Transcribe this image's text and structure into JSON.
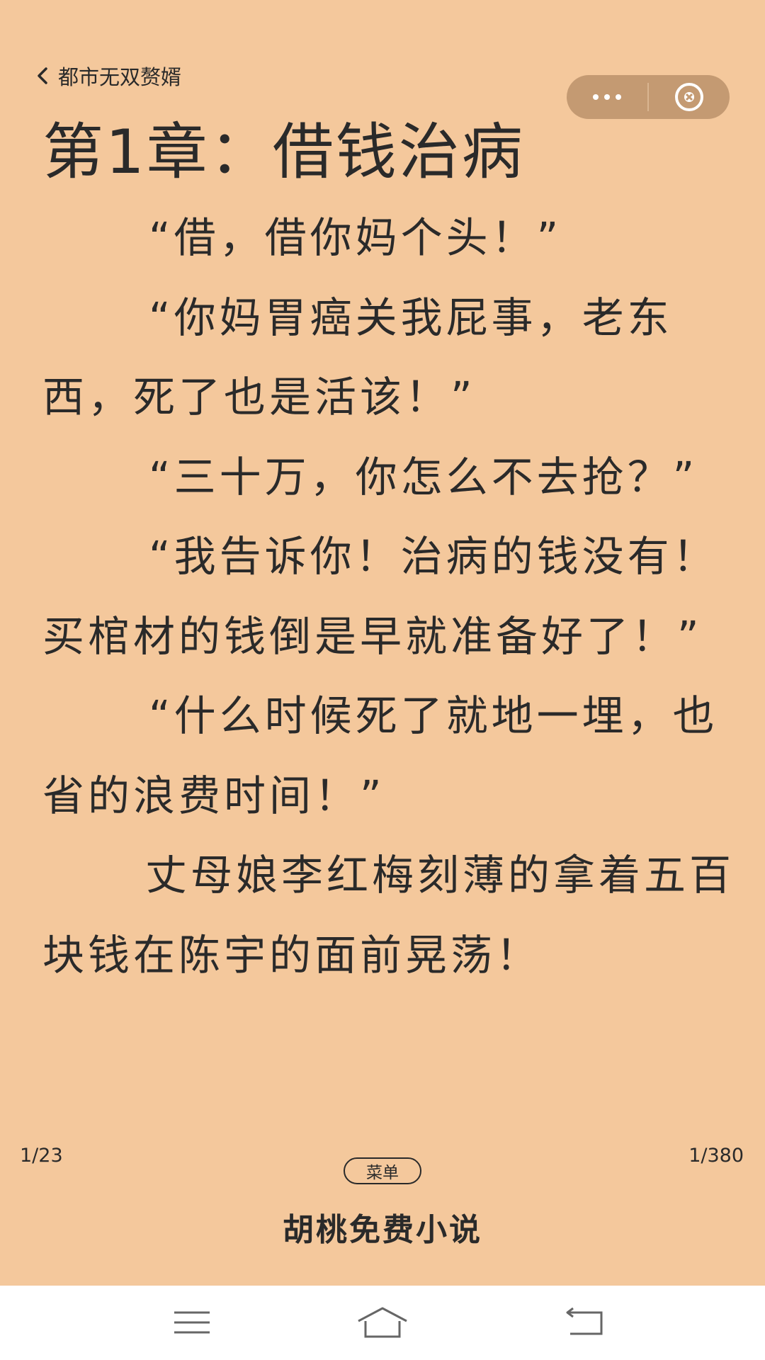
{
  "header": {
    "back_label": "都市无双赘婿",
    "more_icon": "more-dots-icon",
    "close_icon": "close-circle-icon"
  },
  "chapter": {
    "title": "第1章：借钱治病",
    "paragraphs": [
      "“借，借你妈个头！”",
      "“你妈胃癌关我屁事，老东西，死了也是活该！”",
      "“三十万，你怎么不去抢？”",
      "“我告诉你！治病的钱没有！买棺材的钱倒是早就准备好了！”",
      "“什么时候死了就地一埋，也省的浪费时间！”",
      "丈母娘李红梅刻薄的拿着五百块钱在陈宇的面前晃荡！"
    ]
  },
  "footer": {
    "page_in_chapter": "1/23",
    "chapter_progress": "1/380",
    "menu_label": "菜单",
    "brand": "胡桃免费小说"
  },
  "system_nav": {
    "menu_icon": "recent-apps-icon",
    "home_icon": "home-icon",
    "back_icon": "back-icon"
  },
  "colors": {
    "page_background": "#f4c89c",
    "text": "#2a2a2a",
    "capsule": "#c49a72",
    "nav_background": "#ffffff"
  }
}
